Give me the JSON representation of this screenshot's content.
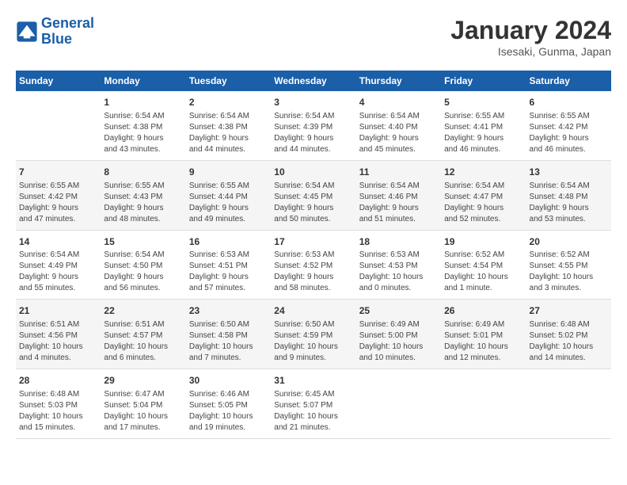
{
  "header": {
    "logo_general": "General",
    "logo_blue": "Blue",
    "title": "January 2024",
    "location": "Isesaki, Gunma, Japan"
  },
  "days_of_week": [
    "Sunday",
    "Monday",
    "Tuesday",
    "Wednesday",
    "Thursday",
    "Friday",
    "Saturday"
  ],
  "weeks": [
    [
      {
        "day": "",
        "info": ""
      },
      {
        "day": "1",
        "info": "Sunrise: 6:54 AM\nSunset: 4:38 PM\nDaylight: 9 hours\nand 43 minutes."
      },
      {
        "day": "2",
        "info": "Sunrise: 6:54 AM\nSunset: 4:38 PM\nDaylight: 9 hours\nand 44 minutes."
      },
      {
        "day": "3",
        "info": "Sunrise: 6:54 AM\nSunset: 4:39 PM\nDaylight: 9 hours\nand 44 minutes."
      },
      {
        "day": "4",
        "info": "Sunrise: 6:54 AM\nSunset: 4:40 PM\nDaylight: 9 hours\nand 45 minutes."
      },
      {
        "day": "5",
        "info": "Sunrise: 6:55 AM\nSunset: 4:41 PM\nDaylight: 9 hours\nand 46 minutes."
      },
      {
        "day": "6",
        "info": "Sunrise: 6:55 AM\nSunset: 4:42 PM\nDaylight: 9 hours\nand 46 minutes."
      }
    ],
    [
      {
        "day": "7",
        "info": "Sunrise: 6:55 AM\nSunset: 4:42 PM\nDaylight: 9 hours\nand 47 minutes."
      },
      {
        "day": "8",
        "info": "Sunrise: 6:55 AM\nSunset: 4:43 PM\nDaylight: 9 hours\nand 48 minutes."
      },
      {
        "day": "9",
        "info": "Sunrise: 6:55 AM\nSunset: 4:44 PM\nDaylight: 9 hours\nand 49 minutes."
      },
      {
        "day": "10",
        "info": "Sunrise: 6:54 AM\nSunset: 4:45 PM\nDaylight: 9 hours\nand 50 minutes."
      },
      {
        "day": "11",
        "info": "Sunrise: 6:54 AM\nSunset: 4:46 PM\nDaylight: 9 hours\nand 51 minutes."
      },
      {
        "day": "12",
        "info": "Sunrise: 6:54 AM\nSunset: 4:47 PM\nDaylight: 9 hours\nand 52 minutes."
      },
      {
        "day": "13",
        "info": "Sunrise: 6:54 AM\nSunset: 4:48 PM\nDaylight: 9 hours\nand 53 minutes."
      }
    ],
    [
      {
        "day": "14",
        "info": "Sunrise: 6:54 AM\nSunset: 4:49 PM\nDaylight: 9 hours\nand 55 minutes."
      },
      {
        "day": "15",
        "info": "Sunrise: 6:54 AM\nSunset: 4:50 PM\nDaylight: 9 hours\nand 56 minutes."
      },
      {
        "day": "16",
        "info": "Sunrise: 6:53 AM\nSunset: 4:51 PM\nDaylight: 9 hours\nand 57 minutes."
      },
      {
        "day": "17",
        "info": "Sunrise: 6:53 AM\nSunset: 4:52 PM\nDaylight: 9 hours\nand 58 minutes."
      },
      {
        "day": "18",
        "info": "Sunrise: 6:53 AM\nSunset: 4:53 PM\nDaylight: 10 hours\nand 0 minutes."
      },
      {
        "day": "19",
        "info": "Sunrise: 6:52 AM\nSunset: 4:54 PM\nDaylight: 10 hours\nand 1 minute."
      },
      {
        "day": "20",
        "info": "Sunrise: 6:52 AM\nSunset: 4:55 PM\nDaylight: 10 hours\nand 3 minutes."
      }
    ],
    [
      {
        "day": "21",
        "info": "Sunrise: 6:51 AM\nSunset: 4:56 PM\nDaylight: 10 hours\nand 4 minutes."
      },
      {
        "day": "22",
        "info": "Sunrise: 6:51 AM\nSunset: 4:57 PM\nDaylight: 10 hours\nand 6 minutes."
      },
      {
        "day": "23",
        "info": "Sunrise: 6:50 AM\nSunset: 4:58 PM\nDaylight: 10 hours\nand 7 minutes."
      },
      {
        "day": "24",
        "info": "Sunrise: 6:50 AM\nSunset: 4:59 PM\nDaylight: 10 hours\nand 9 minutes."
      },
      {
        "day": "25",
        "info": "Sunrise: 6:49 AM\nSunset: 5:00 PM\nDaylight: 10 hours\nand 10 minutes."
      },
      {
        "day": "26",
        "info": "Sunrise: 6:49 AM\nSunset: 5:01 PM\nDaylight: 10 hours\nand 12 minutes."
      },
      {
        "day": "27",
        "info": "Sunrise: 6:48 AM\nSunset: 5:02 PM\nDaylight: 10 hours\nand 14 minutes."
      }
    ],
    [
      {
        "day": "28",
        "info": "Sunrise: 6:48 AM\nSunset: 5:03 PM\nDaylight: 10 hours\nand 15 minutes."
      },
      {
        "day": "29",
        "info": "Sunrise: 6:47 AM\nSunset: 5:04 PM\nDaylight: 10 hours\nand 17 minutes."
      },
      {
        "day": "30",
        "info": "Sunrise: 6:46 AM\nSunset: 5:05 PM\nDaylight: 10 hours\nand 19 minutes."
      },
      {
        "day": "31",
        "info": "Sunrise: 6:45 AM\nSunset: 5:07 PM\nDaylight: 10 hours\nand 21 minutes."
      },
      {
        "day": "",
        "info": ""
      },
      {
        "day": "",
        "info": ""
      },
      {
        "day": "",
        "info": ""
      }
    ]
  ]
}
